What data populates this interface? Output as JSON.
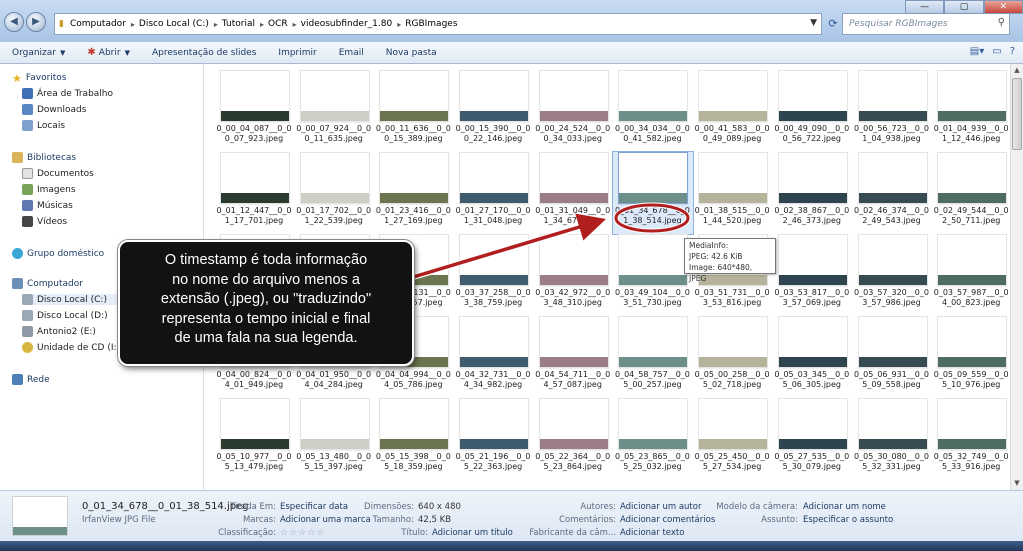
{
  "nav": {
    "back": "◀",
    "forward": "▶"
  },
  "address": {
    "crumbs": [
      "Computador",
      "Disco Local (C:)",
      "Tutorial",
      "OCR",
      "videosubfinder_1.80",
      "RGBImages"
    ],
    "end_arrow": "▼"
  },
  "search": {
    "placeholder": "Pesquisar RGBImages"
  },
  "window_buttons": {
    "min": "—",
    "max": "▢",
    "close": "✕"
  },
  "toolbar": {
    "organize": "Organizar",
    "open": "Abrir",
    "slideshow": "Apresentação de slides",
    "print": "Imprimir",
    "email": "Email",
    "new_folder": "Nova pasta"
  },
  "sidebar": {
    "favorites": "Favoritos",
    "desktop": "Área de Trabalho",
    "downloads": "Downloads",
    "places": "Locais",
    "libraries": "Bibliotecas",
    "documents": "Documentos",
    "images": "Imagens",
    "music": "Músicas",
    "videos": "Vídeos",
    "homegroup": "Grupo doméstico",
    "computer": "Computador",
    "disk_c": "Disco Local (C:)",
    "disk_d": "Disco Local (D:)",
    "antonio": "Antonio2 (E:)",
    "cd": "Unidade de CD (I:)",
    "network": "Rede"
  },
  "files": [
    [
      "0_00_04_087__0_0",
      "0_07_923.jpeg"
    ],
    [
      "0_00_07_924__0_0",
      "0_11_635.jpeg"
    ],
    [
      "0_00_11_636__0_0",
      "0_15_389.jpeg"
    ],
    [
      "0_00_15_390__0_0",
      "0_22_146.jpeg"
    ],
    [
      "0_00_24_524__0_0",
      "0_34_033.jpeg"
    ],
    [
      "0_00_34_034__0_0",
      "0_41_582.jpeg"
    ],
    [
      "0_00_41_583__0_0",
      "0_49_089.jpeg"
    ],
    [
      "0_00_49_090__0_0",
      "0_56_722.jpeg"
    ],
    [
      "0_00_56_723__0_0",
      "1_04_938.jpeg"
    ],
    [
      "0_01_04_939__0_0",
      "1_12_446.jpeg"
    ],
    [
      "0_01_12_447__0_0",
      "1_17_701.jpeg"
    ],
    [
      "0_01_17_702__0_0",
      "1_22_539.jpeg"
    ],
    [
      "0_01_23_416__0_0",
      "1_27_169.jpeg"
    ],
    [
      "0_01_27_170__0_0",
      "1_31_048.jpeg"
    ],
    [
      "0_01_31_049__0_0",
      "1_34_677.jpeg"
    ],
    [
      "0_01_34_678__0_0",
      "1_38_514.jpeg"
    ],
    [
      "0_01_38_515__0_0",
      "1_44_520.jpeg"
    ],
    [
      "0_02_38_867__0_0",
      "2_46_373.jpeg"
    ],
    [
      "0_02_46_374__0_0",
      "2_49_543.jpeg"
    ],
    [
      "0_02_49_544__0_0",
      "2_50_711.jpeg"
    ],
    [
      "",
      ""
    ],
    [
      "",
      ""
    ],
    [
      "0_03_35_131__0_0",
      "3_37_257.jpeg"
    ],
    [
      "0_03_37_258__0_0",
      "3_38_759.jpeg"
    ],
    [
      "0_03_42_972__0_0",
      "3_48_310.jpeg"
    ],
    [
      "0_03_49_104__0_0",
      "3_51_730.jpeg"
    ],
    [
      "0_03_51_731__0_0",
      "3_53_816.jpeg"
    ],
    [
      "0_03_53_817__0_0",
      "3_57_069.jpeg"
    ],
    [
      "0_03_57_320__0_0",
      "3_57_986.jpeg"
    ],
    [
      "0_03_57_987__0_0",
      "4_00_823.jpeg"
    ],
    [
      "0_04_00_824__0_0",
      "4_01_949.jpeg"
    ],
    [
      "0_04_01_950__0_0",
      "4_04_284.jpeg"
    ],
    [
      "0_04_04_994__0_0",
      "4_05_786.jpeg"
    ],
    [
      "0_04_32_731__0_0",
      "4_34_982.jpeg"
    ],
    [
      "0_04_54_711__0_0",
      "4_57_087.jpeg"
    ],
    [
      "0_04_58_757__0_0",
      "5_00_257.jpeg"
    ],
    [
      "0_05_00_258__0_0",
      "5_02_718.jpeg"
    ],
    [
      "0_05_03_345__0_0",
      "5_06_305.jpeg"
    ],
    [
      "0_05_06_931__0_0",
      "5_09_558.jpeg"
    ],
    [
      "0_05_09_559__0_0",
      "5_10_976.jpeg"
    ],
    [
      "0_05_10_977__0_0",
      "5_13_479.jpeg"
    ],
    [
      "0_05_13_480__0_0",
      "5_15_397.jpeg"
    ],
    [
      "0_05_15_398__0_0",
      "5_18_359.jpeg"
    ],
    [
      "0_05_21_196__0_0",
      "5_22_363.jpeg"
    ],
    [
      "0_05_22_364__0_0",
      "5_23_864.jpeg"
    ],
    [
      "0_05_23_865__0_0",
      "5_25_032.jpeg"
    ],
    [
      "0_05_25_450__0_0",
      "5_27_534.jpeg"
    ],
    [
      "0_05_27_535__0_0",
      "5_30_079.jpeg"
    ],
    [
      "0_05_30_080__0_0",
      "5_32_331.jpeg"
    ],
    [
      "0_05_32_749__0_0",
      "5_33_916.jpeg"
    ]
  ],
  "thumb_colors": [
    "#2a3b2f",
    "#cfcfc6",
    "#6b7650",
    "#3f5c6e",
    "#9a7d89",
    "#6c8f8a",
    "#b5b39a",
    "#2e4550",
    "#384a52",
    "#4f6c60"
  ],
  "selected_index": 15,
  "tooltip": {
    "title": "MediaInfo:",
    "line1": "JPEG: 42.6 KiB",
    "line2": "Image: 640*480, JPEG"
  },
  "callout": {
    "lines": [
      "O timestamp é toda informação",
      "no nome do arquivo menos a",
      "extensão (.jpeg), ou \"traduzindo\"",
      "representa o tempo inicial e final",
      "de uma fala na sua legenda."
    ]
  },
  "details": {
    "filename": "0_01_34_678__0_01_38_514.jpeg",
    "filetype": "IrfanView JPG File",
    "taken_label": "Tirada Em:",
    "taken_value": "Especificar data",
    "tags_label": "Marcas:",
    "tags_value": "Adicionar uma marca",
    "rating_label": "Classificação:",
    "rating_value": "☆☆☆☆☆",
    "dimensions_label": "Dimensões:",
    "dimensions_value": "640 x 480",
    "size_label": "Tamanho:",
    "size_value": "42,5 KB",
    "title_label": "Título:",
    "title_value": "Adicionar um título",
    "authors_label": "Autores:",
    "authors_value": "Adicionar um autor",
    "comments_label": "Comentários:",
    "comments_value": "Adicionar comentários",
    "maker_label": "Fabricante da câm...",
    "maker_value": "Adicionar texto",
    "model_label": "Modelo da câmera:",
    "model_value": "Adicionar um nome",
    "subject_label": "Assunto:",
    "subject_value": "Especificar o assunto"
  }
}
